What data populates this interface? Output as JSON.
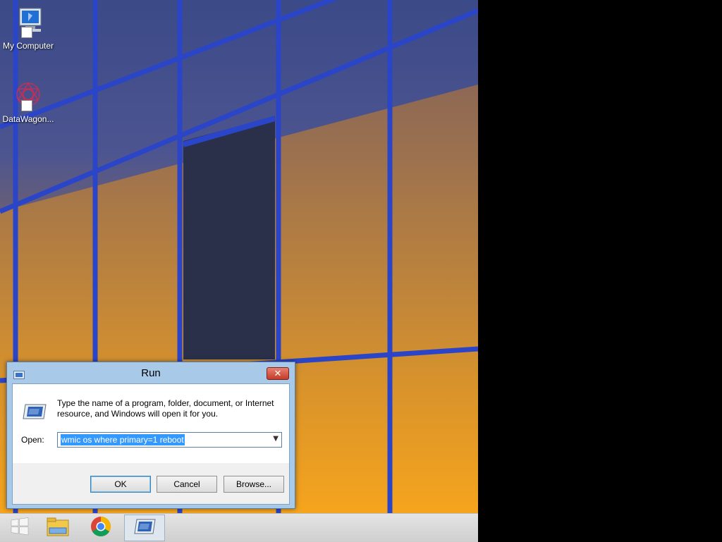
{
  "desktop": {
    "icons": [
      {
        "label": "My Computer",
        "icon": "computer-icon"
      },
      {
        "label": "DataWagon...",
        "icon": "datawagon-icon"
      }
    ]
  },
  "run_dialog": {
    "title": "Run",
    "description": "Type the name of a program, folder, document, or Internet resource, and Windows will open it for you.",
    "open_label": "Open:",
    "open_value": "wmic os where primary=1 reboot",
    "ok_label": "OK",
    "cancel_label": "Cancel",
    "browse_label": "Browse...",
    "close_glyph": "✕"
  },
  "taskbar": {
    "items": [
      {
        "icon": "windows-start-icon"
      },
      {
        "icon": "file-explorer-icon"
      },
      {
        "icon": "chrome-icon"
      },
      {
        "icon": "run-app-icon",
        "active": true
      }
    ]
  }
}
